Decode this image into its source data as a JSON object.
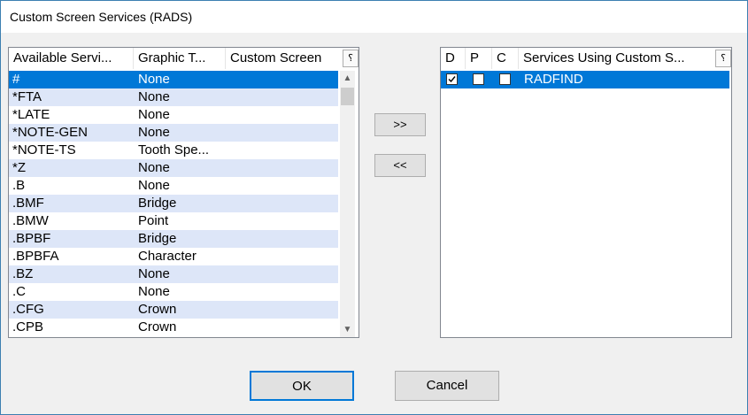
{
  "window": {
    "title": "Custom Screen Services (RADS)"
  },
  "left_list": {
    "headers": [
      "Available Servi...",
      "Graphic T...",
      "Custom Screen"
    ],
    "rows": [
      [
        "#",
        "None"
      ],
      [
        "*FTA",
        "None"
      ],
      [
        "*LATE",
        "None"
      ],
      [
        "*NOTE-GEN",
        "None"
      ],
      [
        "*NOTE-TS",
        "Tooth Spe..."
      ],
      [
        "*Z",
        "None"
      ],
      [
        ".B",
        "None"
      ],
      [
        ".BMF",
        "Bridge"
      ],
      [
        ".BMW",
        "Point"
      ],
      [
        ".BPBF",
        "Bridge"
      ],
      [
        ".BPBFA",
        "Character"
      ],
      [
        ".BZ",
        "None"
      ],
      [
        ".C",
        "None"
      ],
      [
        ".CFG",
        "Crown"
      ],
      [
        ".CPB",
        "Crown"
      ]
    ],
    "selected_index": 0
  },
  "right_list": {
    "headers": [
      "D",
      "P",
      "C",
      "Services Using Custom S..."
    ],
    "rows": [
      {
        "d": true,
        "p": false,
        "c": false,
        "name": "RADFIND"
      }
    ]
  },
  "buttons": {
    "add": ">>",
    "remove": "<<",
    "ok": "OK",
    "cancel": "Cancel"
  },
  "icons": {
    "column_chooser": "column-chooser-icon",
    "scroll_up": "scroll-up-arrow",
    "scroll_down": "scroll-down-arrow"
  },
  "colors": {
    "selection": "#0078d7",
    "alt_row": "#dde6f8",
    "focus_border": "#0078d7"
  }
}
